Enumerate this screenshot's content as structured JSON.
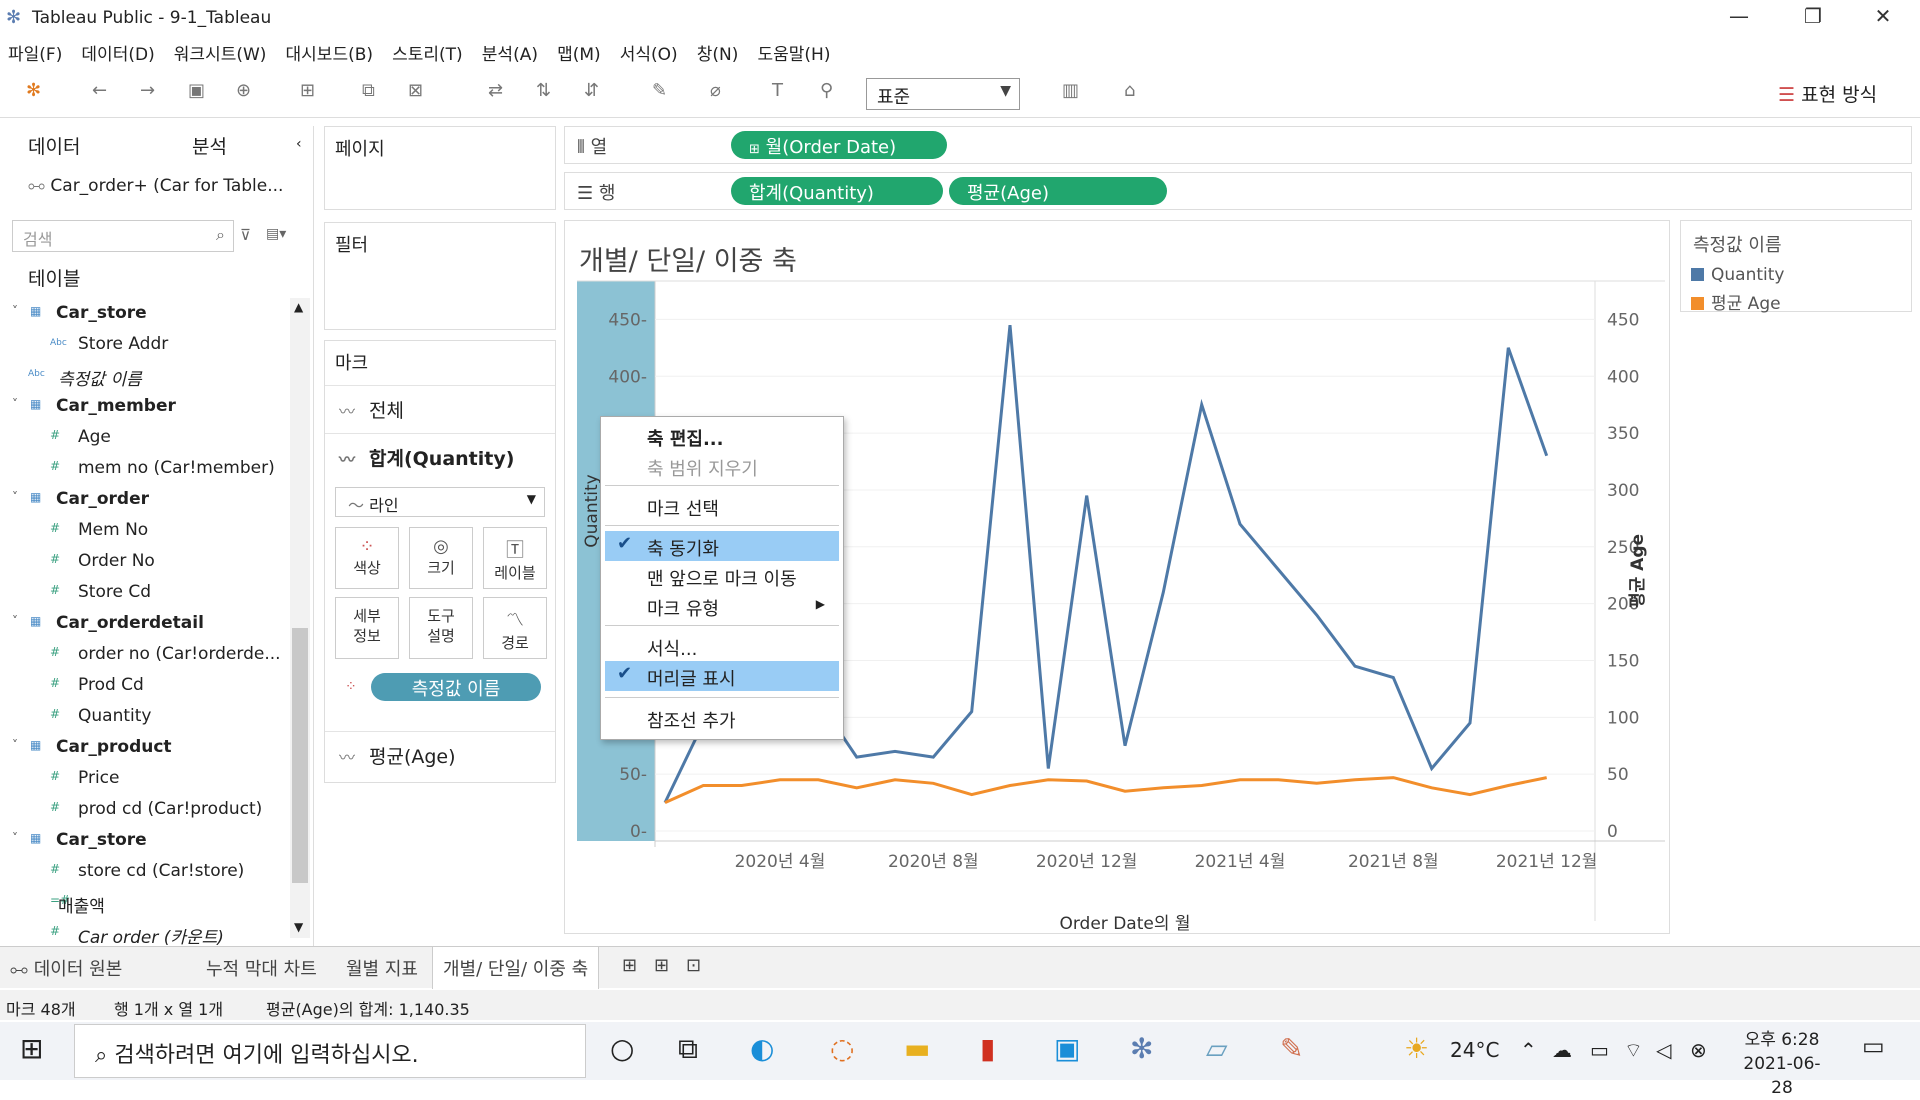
{
  "window": {
    "title": "Tableau Public - 9-1_Tableau"
  },
  "menu": [
    "파일(F)",
    "데이터(D)",
    "워크시트(W)",
    "대시보드(B)",
    "스토리(T)",
    "분석(A)",
    "맵(M)",
    "서식(O)",
    "창(N)",
    "도움말(H)"
  ],
  "toolbar": {
    "fit": "표준",
    "show_me": "표현 방식"
  },
  "data_pane": {
    "tab_data": "데이터",
    "tab_analysis": "분석",
    "datasource": "Car_order+ (Car for Table...",
    "search_placeholder": "검색",
    "tables_header": "테이블",
    "fields": [
      {
        "kind": "table",
        "label": "Car_store"
      },
      {
        "kind": "abc",
        "label": "Store Addr"
      },
      {
        "kind": "abc-it",
        "label": "측정값 이름"
      },
      {
        "kind": "table",
        "label": "Car_member"
      },
      {
        "kind": "num",
        "label": "Age"
      },
      {
        "kind": "num",
        "label": "mem no (Car!member)"
      },
      {
        "kind": "table",
        "label": "Car_order"
      },
      {
        "kind": "num",
        "label": "Mem No"
      },
      {
        "kind": "num",
        "label": "Order No"
      },
      {
        "kind": "num",
        "label": "Store Cd"
      },
      {
        "kind": "table",
        "label": "Car_orderdetail"
      },
      {
        "kind": "num",
        "label": "order no (Car!orderde..."
      },
      {
        "kind": "num",
        "label": "Prod Cd"
      },
      {
        "kind": "num",
        "label": "Quantity"
      },
      {
        "kind": "table",
        "label": "Car_product"
      },
      {
        "kind": "num",
        "label": "Price"
      },
      {
        "kind": "num",
        "label": "prod cd (Car!product)"
      },
      {
        "kind": "table",
        "label": "Car_store"
      },
      {
        "kind": "num",
        "label": "store cd (Car!store)"
      },
      {
        "kind": "calc",
        "label": "매출액"
      },
      {
        "kind": "num-it",
        "label": "Car order (카운트)"
      }
    ]
  },
  "shelves": {
    "pages": "페이지",
    "filters": "필터",
    "marks": "마크",
    "columns_label": "열",
    "rows_label": "행",
    "columns_pill": "월(Order Date)",
    "rows_pills": [
      "합계(Quantity)",
      "평균(Age)"
    ]
  },
  "marks": {
    "all": "전체",
    "quantity": "합계(Quantity)",
    "type": "라인",
    "buttons": [
      "색상",
      "크기",
      "레이블",
      "세부\n정보",
      "도구\n설명",
      "경로"
    ],
    "pill": "측정값 이름",
    "age": "평균(Age)"
  },
  "view": {
    "title": "개별/ 단일/ 이중 축"
  },
  "legend": {
    "header": "측정값 이름",
    "items": [
      {
        "label": "Quantity",
        "color": "#4e79a7"
      },
      {
        "label": "평균 Age",
        "color": "#f28e2b"
      }
    ]
  },
  "context_menu": [
    "축 편집...",
    "축 범위 지우기",
    "마크 선택",
    "축 동기화",
    "맨 앞으로 마크 이동",
    "마크 유형",
    "서식...",
    "머리글 표시",
    "참조선 추가"
  ],
  "chart_data": {
    "type": "line",
    "title": "",
    "xlabel": "Order Date의 월",
    "ylabel": "Quantity",
    "y2label": "평균 Age",
    "x_ticks": [
      "2020년 4월",
      "2020년 8월",
      "2020년 12월",
      "2021년 4월",
      "2021년 8월",
      "2021년 12월"
    ],
    "ylim": [
      0,
      475
    ],
    "y_ticks": [
      0,
      50,
      100,
      150,
      200,
      250,
      300,
      350,
      400,
      450
    ],
    "x": [
      "2020-01",
      "2020-02",
      "2020-03",
      "2020-04",
      "2020-05",
      "2020-06",
      "2020-07",
      "2020-08",
      "2020-09",
      "2020-10",
      "2020-11",
      "2020-12",
      "2021-01",
      "2021-02",
      "2021-03",
      "2021-04",
      "2021-05",
      "2021-06",
      "2021-07",
      "2021-08",
      "2021-09",
      "2021-10",
      "2021-11",
      "2021-12",
      "2022-01"
    ],
    "series": [
      {
        "name": "Quantity",
        "color": "#4e79a7",
        "values": [
          25,
          95,
          210,
          160,
          115,
          65,
          70,
          65,
          105,
          445,
          55,
          295,
          75,
          210,
          375,
          270,
          230,
          190,
          145,
          135,
          55,
          95,
          425,
          330,
          null
        ]
      },
      {
        "name": "평균 Age",
        "color": "#f28e2b",
        "values": [
          25,
          40,
          40,
          45,
          45,
          38,
          45,
          42,
          32,
          40,
          45,
          44,
          35,
          38,
          40,
          45,
          45,
          42,
          45,
          47,
          38,
          32,
          40,
          47,
          null
        ]
      }
    ]
  },
  "sheet_tabs": [
    "데이터 원본",
    "누적 막대 차트",
    "월별 지표",
    "개별/ 단일/ 이중 축"
  ],
  "status": {
    "marks": "마크 48개",
    "rows": "행 1개 x 열 1개",
    "sum": "평균(Age)의 합계: 1,140.35"
  },
  "taskbar": {
    "search": "검색하려면 여기에 입력하십시오.",
    "temp": "24°C",
    "time": "오후 6:28",
    "date": "2021-06-28"
  }
}
